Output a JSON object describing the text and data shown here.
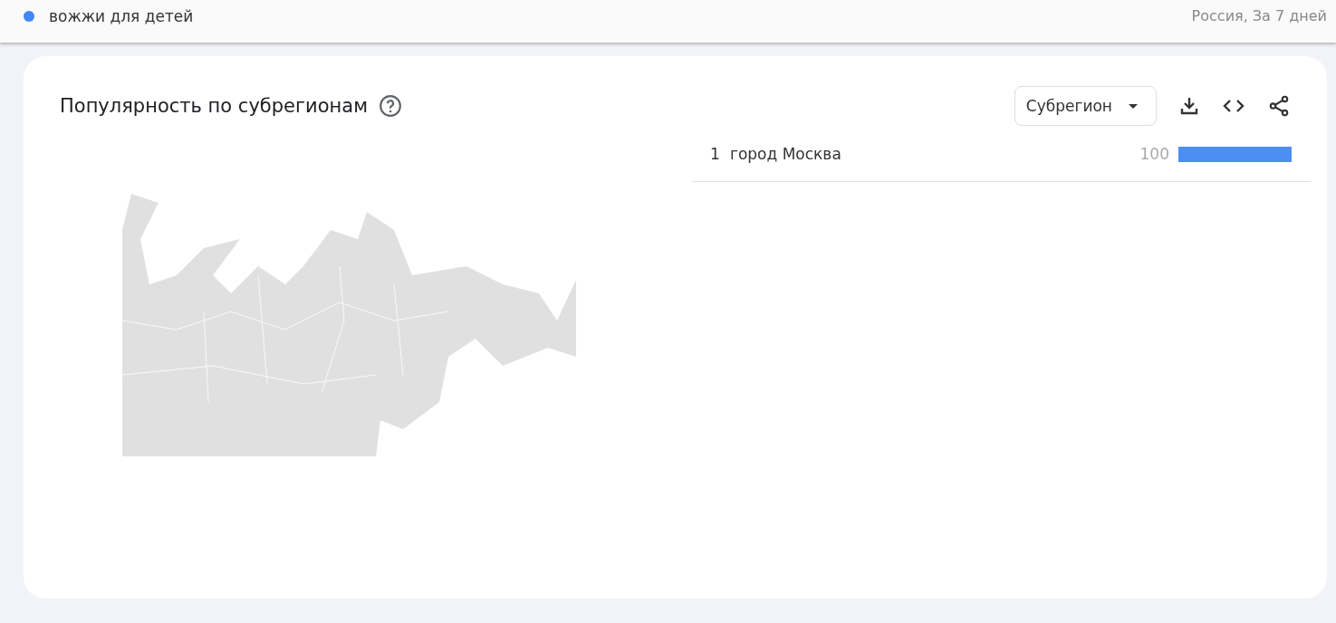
{
  "top_bar": {
    "term": {
      "label": "вожжи для детей",
      "color": "#4285f4"
    },
    "scope": "Россия, За 7 дней"
  },
  "panel": {
    "title": "Популярность по субрегионам",
    "dropdown": "Субрегион",
    "rows": [
      {
        "rank": "1",
        "name": "город Москва",
        "value": "100",
        "level": 1
      }
    ]
  }
}
